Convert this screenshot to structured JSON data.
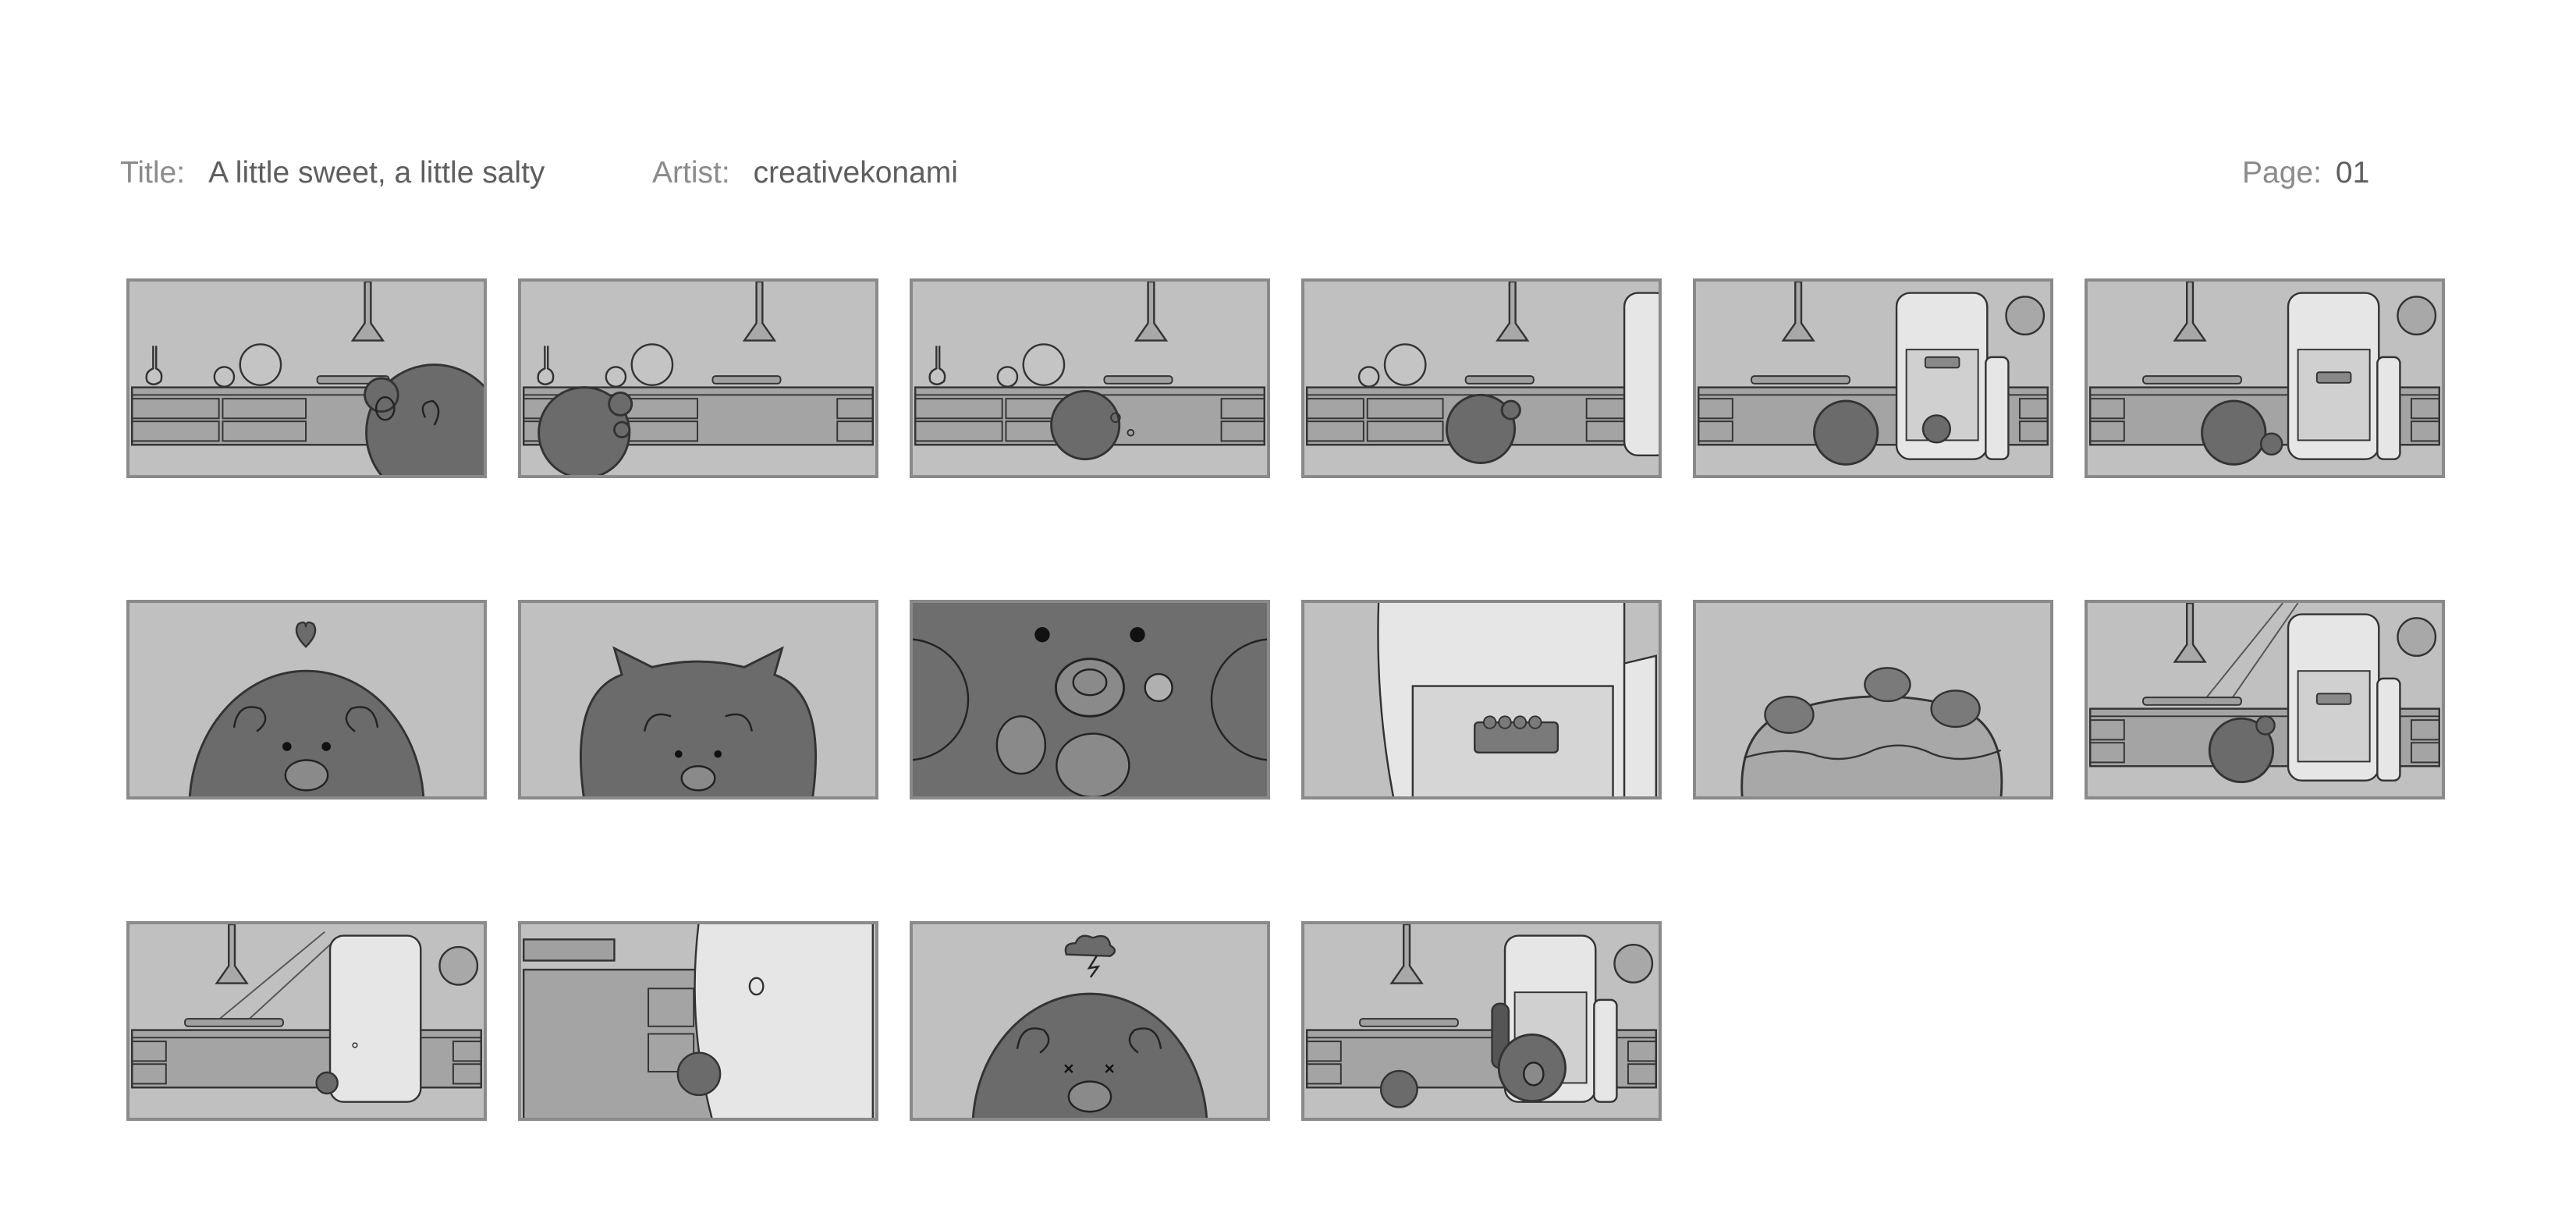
{
  "header": {
    "title_label": "Title:",
    "title_value": "A little sweet, a little salty",
    "artist_label": "Artist:",
    "artist_value": "creativekonami",
    "page_label": "Page:",
    "page_value": "01"
  },
  "storyboard": {
    "panel_count": 16,
    "colors": {
      "panel_bg": "#c0c0c0",
      "panel_border": "#8a8a8a",
      "character": "#6b6b6b",
      "fridge": "#e6e6e6",
      "dark_bg": "#6e6e6e",
      "label_text": "#8b8b8b",
      "value_text": "#5e5e5e"
    }
  }
}
